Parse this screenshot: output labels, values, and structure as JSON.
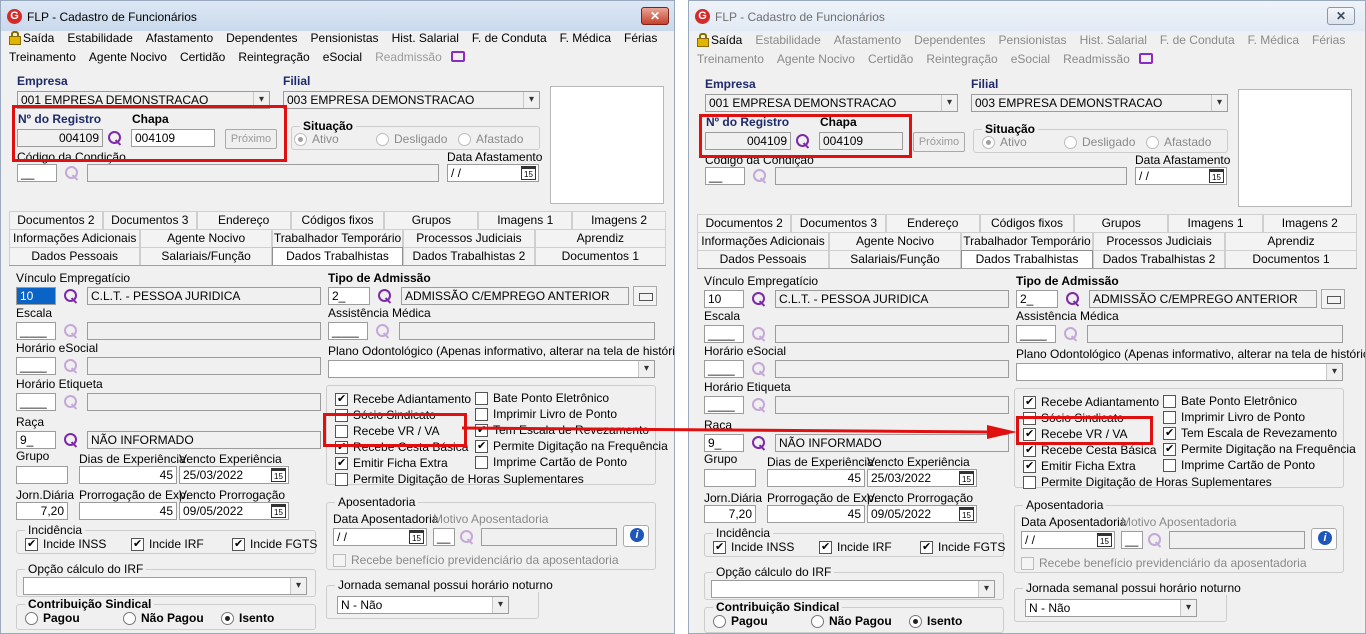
{
  "window": {
    "title": "FLP - Cadastro de Funcionários",
    "close": "✕"
  },
  "menu": {
    "row1": [
      "Saída",
      "Estabilidade",
      "Afastamento",
      "Dependentes",
      "Pensionistas",
      "Hist. Salarial",
      "F. de Conduta",
      "F. Médica",
      "Férias"
    ],
    "row2": [
      "Treinamento",
      "Agente Nocivo",
      "Certidão",
      "Reintegração",
      "eSocial",
      "Readmissão"
    ]
  },
  "header": {
    "empresa_label": "Empresa",
    "empresa_value": "001 EMPRESA DEMONSTRACAO",
    "filial_label": "Filial",
    "filial_value": "003 EMPRESA DEMONSTRACAO",
    "registro_label": "Nº do Registro",
    "registro_value": "004109",
    "chapa_label": "Chapa",
    "chapa_value": "004109",
    "proximo_label": "Próximo",
    "situacao_label": "Situação",
    "situacao_ativo": "Ativo",
    "situacao_desligado": "Desligado",
    "situacao_afastado": "Afastado",
    "condicao_label": "Código da Condição",
    "condicao_value": "__",
    "data_afastamento_label": "Data Afastamento",
    "data_afastamento_value": " /  /",
    "calendar_icon_text": "15"
  },
  "tabs": {
    "row1": [
      "Documentos 2",
      "Documentos 3",
      "Endereço",
      "Códigos fixos",
      "Grupos",
      "Imagens 1",
      "Imagens 2"
    ],
    "row2": [
      "Informações Adicionais",
      "Agente Nocivo",
      "Trabalhador Temporário",
      "Processos Judiciais",
      "Aprendiz"
    ],
    "row3": [
      "Dados Pessoais",
      "Salariais/Função",
      "Dados Trabalhistas",
      "Dados Trabalhistas 2",
      "Documentos 1"
    ]
  },
  "form": {
    "vinculo_label": "Vínculo Empregatício",
    "vinculo_code": "10",
    "vinculo_desc": "C.L.T. - PESSOA JURIDICA",
    "tipo_admissao_label": "Tipo de Admissão",
    "tipo_admissao_code": "2_",
    "tipo_admissao_desc": "ADMISSÃO C/EMPREGO ANTERIOR",
    "escala_label": "Escala",
    "escala_code": "____",
    "assistencia_label": "Assistência Médica",
    "assistencia_code": "____",
    "horario_esocial_label": "Horário eSocial",
    "horario_esocial_code": "____",
    "plano_odonto_label": "Plano Odontológico (Apenas informativo, alterar na tela de histórico)",
    "horario_etiqueta_label": "Horário Etiqueta",
    "horario_etiqueta_code": "____",
    "raca_label": "Raça",
    "raca_code": "9_",
    "raca_desc": "NÃO INFORMADO",
    "grupo_label": "Grupo",
    "dias_experiencia_label": "Dias de Experiência",
    "dias_experiencia_value": "45",
    "vencto_experiencia_label": "Vencto Experiência",
    "vencto_experiencia_value": "25/03/2022",
    "jorn_diaria_label": "Jorn.Diária",
    "jorn_diaria_value": "7,20",
    "prorrogacao_label": "Prorrogação de Exp.",
    "prorrogacao_value": "45",
    "vencto_prorrogacao_label": "Vencto Prorrogação",
    "vencto_prorrogacao_value": "09/05/2022",
    "checks": {
      "recebe_adiantamento": "Recebe Adiantamento",
      "socio_sindicato": "Sócio Sindicato",
      "recebe_vr_va": "Recebe VR / VA",
      "recebe_cesta_basica": "Recebe Cesta Básica",
      "emitir_ficha_extra": "Emitir Ficha Extra",
      "permite_horas_suplementares": "Permite Digitação de Horas Suplementares",
      "bate_ponto_eletronico": "Bate Ponto Eletrônico",
      "imprimir_livro_ponto": "Imprimir Livro de Ponto",
      "tem_escala_revezamento": "Tem Escala de Revezamento",
      "permite_digitacao_frequencia": "Permite Digitação na Frequência",
      "imprime_cartao_ponto": "Imprime Cartão de Ponto"
    },
    "incidencia_label": "Incidência",
    "incide_inss": "Incide INSS",
    "incide_irf": "Incide IRF",
    "incide_fgts": "Incide FGTS",
    "opcao_irf_label": "Opção cálculo do IRF",
    "contribuicao_label": "Contribuição Sindical",
    "pagou": "Pagou",
    "nao_pagou": "Não Pagou",
    "isento": "Isento",
    "aposentadoria_label": "Aposentadoria",
    "data_aposentadoria_label": "Data Aposentadoria",
    "motivo_aposentadoria_label": "Motivo Aposentadoria",
    "data_aposentadoria_value": " /  /",
    "motivo_code": "__",
    "recebe_beneficio": "Recebe benefício previdenciário da aposentadoria",
    "jornada_label": "Jornada semanal possui horário noturno",
    "jornada_value": "N - Não"
  },
  "colors": {
    "highlight": "#e01010",
    "accent_purple": "#7d2aa8",
    "selection": "#0a64c8"
  }
}
